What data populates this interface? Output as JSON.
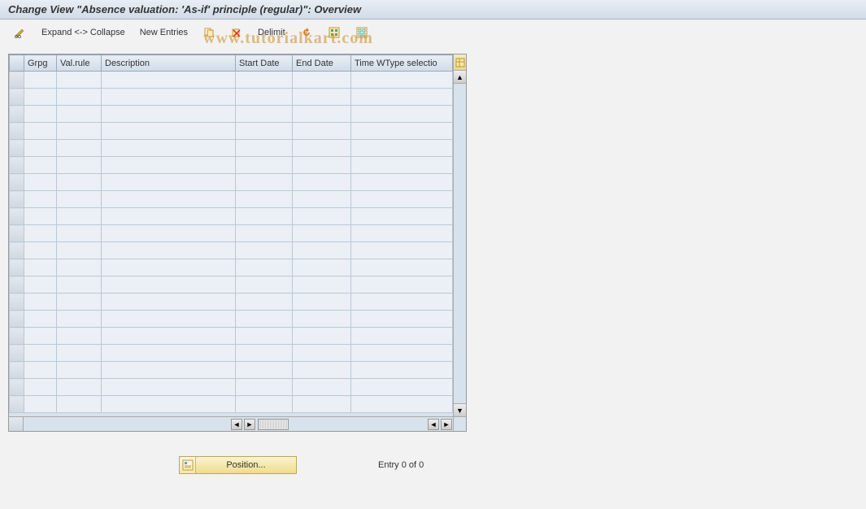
{
  "title": "Change View \"Absence valuation: 'As-if' principle (regular)\": Overview",
  "toolbar": {
    "expand_collapse": "Expand <-> Collapse",
    "new_entries": "New Entries",
    "delimit": "Delimit"
  },
  "columns": {
    "grpg": "Grpg",
    "valrule": "Val.rule",
    "description": "Description",
    "startdate": "Start Date",
    "enddate": "End Date",
    "timewtype": "Time WType selectio"
  },
  "footer": {
    "position_label": "Position...",
    "entry_text": "Entry 0 of 0"
  },
  "watermark": "www.tutorialkart.com",
  "row_count": 20
}
